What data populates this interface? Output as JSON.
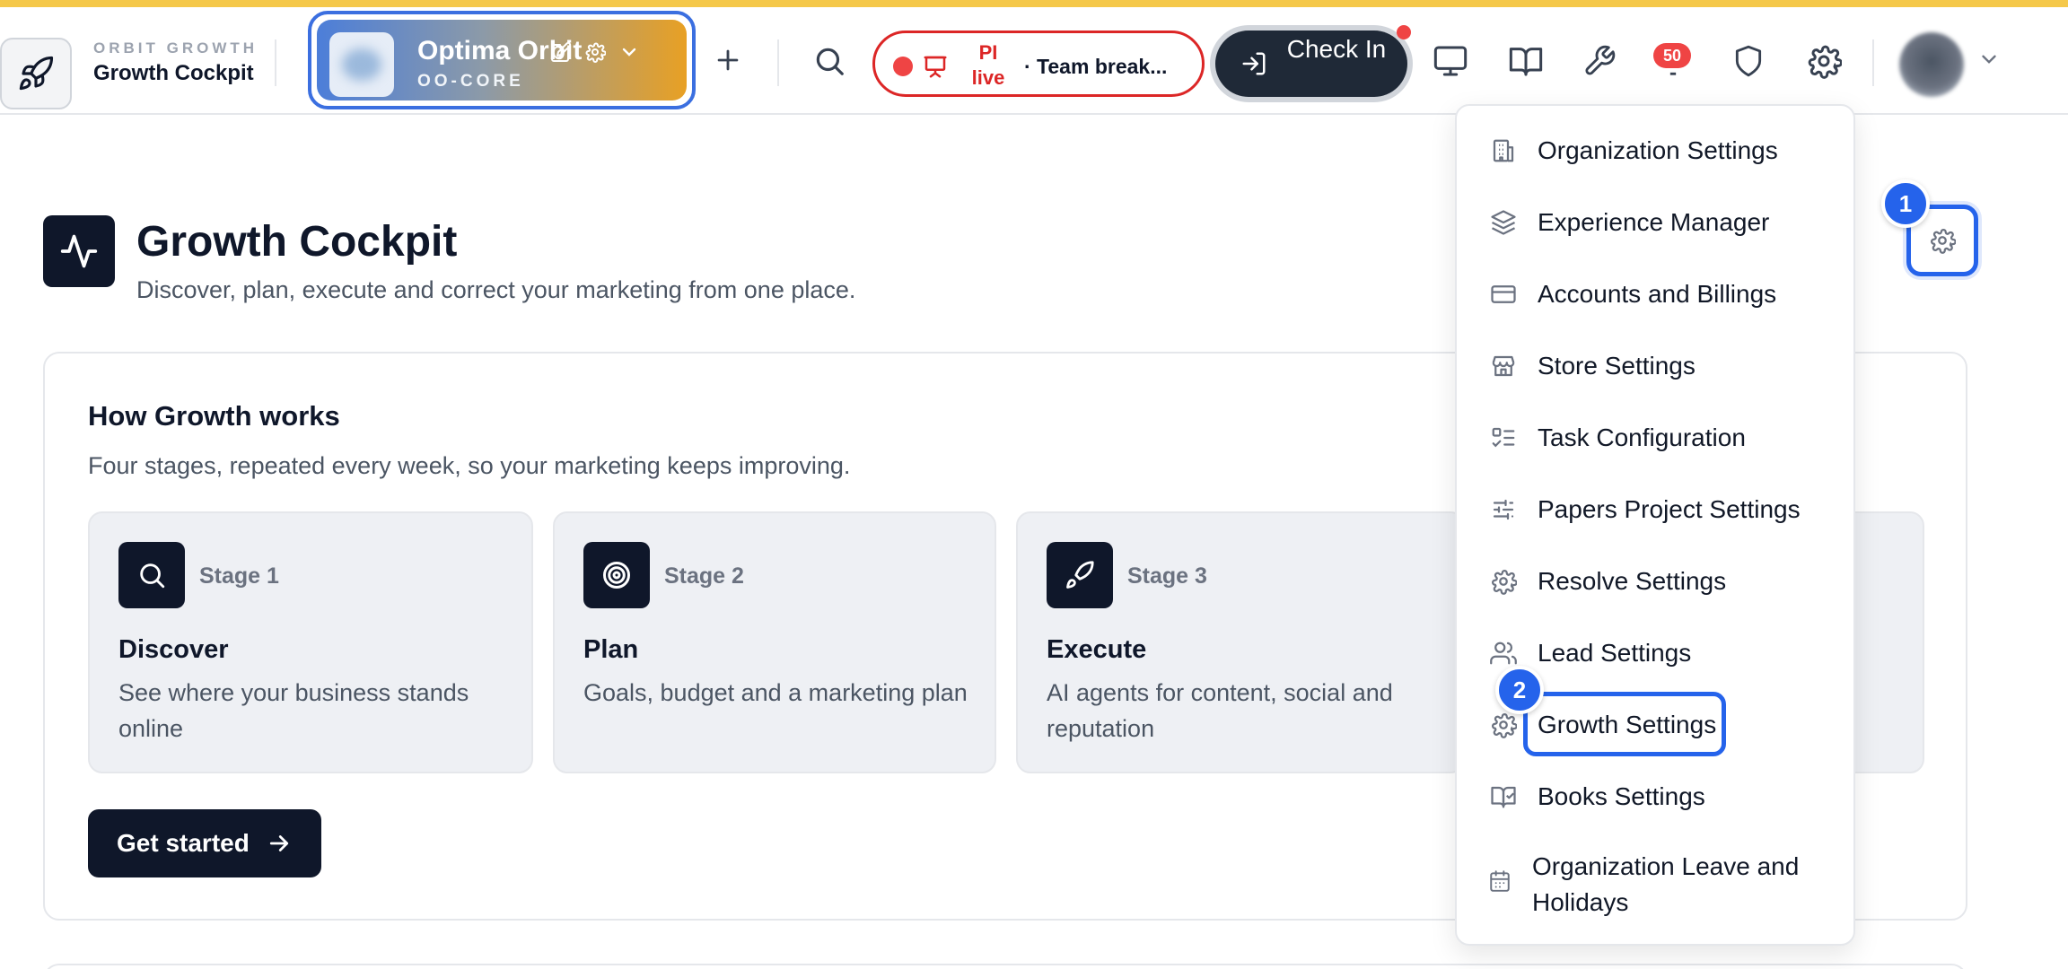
{
  "header": {
    "brand_eyebrow": "ORBIT GROWTH",
    "brand_title": "Growth Cockpit",
    "org": {
      "name": "Optima Orbit",
      "code": "OO-CORE"
    },
    "live": {
      "status": "PI live",
      "meeting": "· Team break..."
    },
    "checkin_label": "Check In",
    "notification_count": "50"
  },
  "page": {
    "title": "Growth Cockpit",
    "subtitle": "Discover, plan, execute and correct your marketing from one place."
  },
  "card": {
    "title": "How Growth works",
    "subtitle": "Four stages, repeated every week, so your marketing keeps improving.",
    "stages": [
      {
        "label": "Stage 1",
        "name": "Discover",
        "desc": "See where your business stands online",
        "icon": "search-icon"
      },
      {
        "label": "Stage 2",
        "name": "Plan",
        "desc": "Goals, budget and a marketing plan",
        "icon": "target-icon"
      },
      {
        "label": "Stage 3",
        "name": "Execute",
        "desc": "AI agents for content, social and reputation",
        "icon": "rocket-icon"
      }
    ],
    "cta": "Get started"
  },
  "dropdown": {
    "items": [
      {
        "label": "Organization Settings",
        "icon": "building-icon"
      },
      {
        "label": "Experience Manager",
        "icon": "layers-icon"
      },
      {
        "label": "Accounts and Billings",
        "icon": "credit-card-icon"
      },
      {
        "label": "Store Settings",
        "icon": "store-icon"
      },
      {
        "label": "Task Configuration",
        "icon": "checklist-icon"
      },
      {
        "label": "Papers Project Settings",
        "icon": "sliders-icon"
      },
      {
        "label": "Resolve Settings",
        "icon": "gear-icon"
      },
      {
        "label": "Lead Settings",
        "icon": "users-icon"
      },
      {
        "label": "Growth Settings",
        "icon": "gear-icon"
      },
      {
        "label": "Books Settings",
        "icon": "book-check-icon"
      },
      {
        "label": "Organization Leave and Holidays",
        "icon": "calendar-icon"
      }
    ]
  },
  "steps": {
    "one": "1",
    "two": "2"
  },
  "colors": {
    "accent": "#2563eb",
    "dark": "#0f172a",
    "live_red": "#dc2626",
    "top_strip": "#f5c84a"
  }
}
